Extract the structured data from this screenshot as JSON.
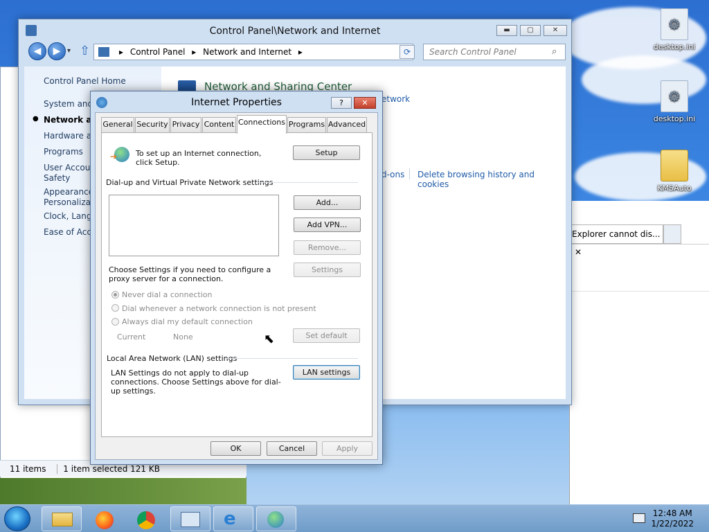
{
  "desktop": {
    "icons": [
      {
        "label": "desktop.ini"
      },
      {
        "label": "desktop.ini"
      },
      {
        "label": "KMSAuto"
      }
    ]
  },
  "control_panel": {
    "title": "Control Panel\\Network and Internet",
    "address": [
      "Control Panel",
      "Network and Internet"
    ],
    "search_placeholder": "Search Control Panel",
    "left_items": [
      "Control Panel Home",
      "System and S",
      "Network an",
      "Hardware an",
      "Programs",
      "User Accoun",
      "Safety",
      "Appearance",
      "Personalizati",
      "Clock, Langu",
      "Ease of Acce"
    ],
    "heading": "Network and Sharing Center",
    "link_partial": "etwork",
    "addons_partial": "d-ons",
    "delete_link": "Delete browsing history and cookies"
  },
  "explorer": {
    "status_items": "11 items",
    "status_selected": "1 item selected  121 KB",
    "tab_title": "Explorer cannot dis...",
    "tab_close": "✕"
  },
  "dialog": {
    "title": "Internet Properties",
    "help": "?",
    "close": "✕",
    "tabs": [
      "General",
      "Security",
      "Privacy",
      "Content",
      "Connections",
      "Programs",
      "Advanced"
    ],
    "active_tab": "Connections",
    "setup_text": "To set up an Internet connection, click Setup.",
    "setup_button": "Setup",
    "vpn_group": "Dial-up and Virtual Private Network settings",
    "add_button": "Add...",
    "add_vpn_button": "Add VPN...",
    "remove_button": "Remove...",
    "settings_text": "Choose Settings if you need to configure a proxy server for a connection.",
    "settings_button": "Settings",
    "radio_never": "Never dial a connection",
    "radio_whenever": "Dial whenever a network connection is not present",
    "radio_always": "Always dial my default connection",
    "current_label": "Current",
    "current_value": "None",
    "set_default_button": "Set default",
    "lan_group": "Local Area Network (LAN) settings",
    "lan_text": "LAN Settings do not apply to dial-up connections. Choose Settings above for dial-up settings.",
    "lan_button": "LAN settings",
    "ok": "OK",
    "cancel": "Cancel",
    "apply": "Apply"
  },
  "taskbar": {
    "time": "12:48 AM",
    "date": "1/22/2022",
    "apps": [
      "file-explorer-icon",
      "firefox-icon",
      "chrome-icon",
      "control-panel-icon",
      "internet-explorer-icon",
      "internet-properties-icon"
    ]
  }
}
